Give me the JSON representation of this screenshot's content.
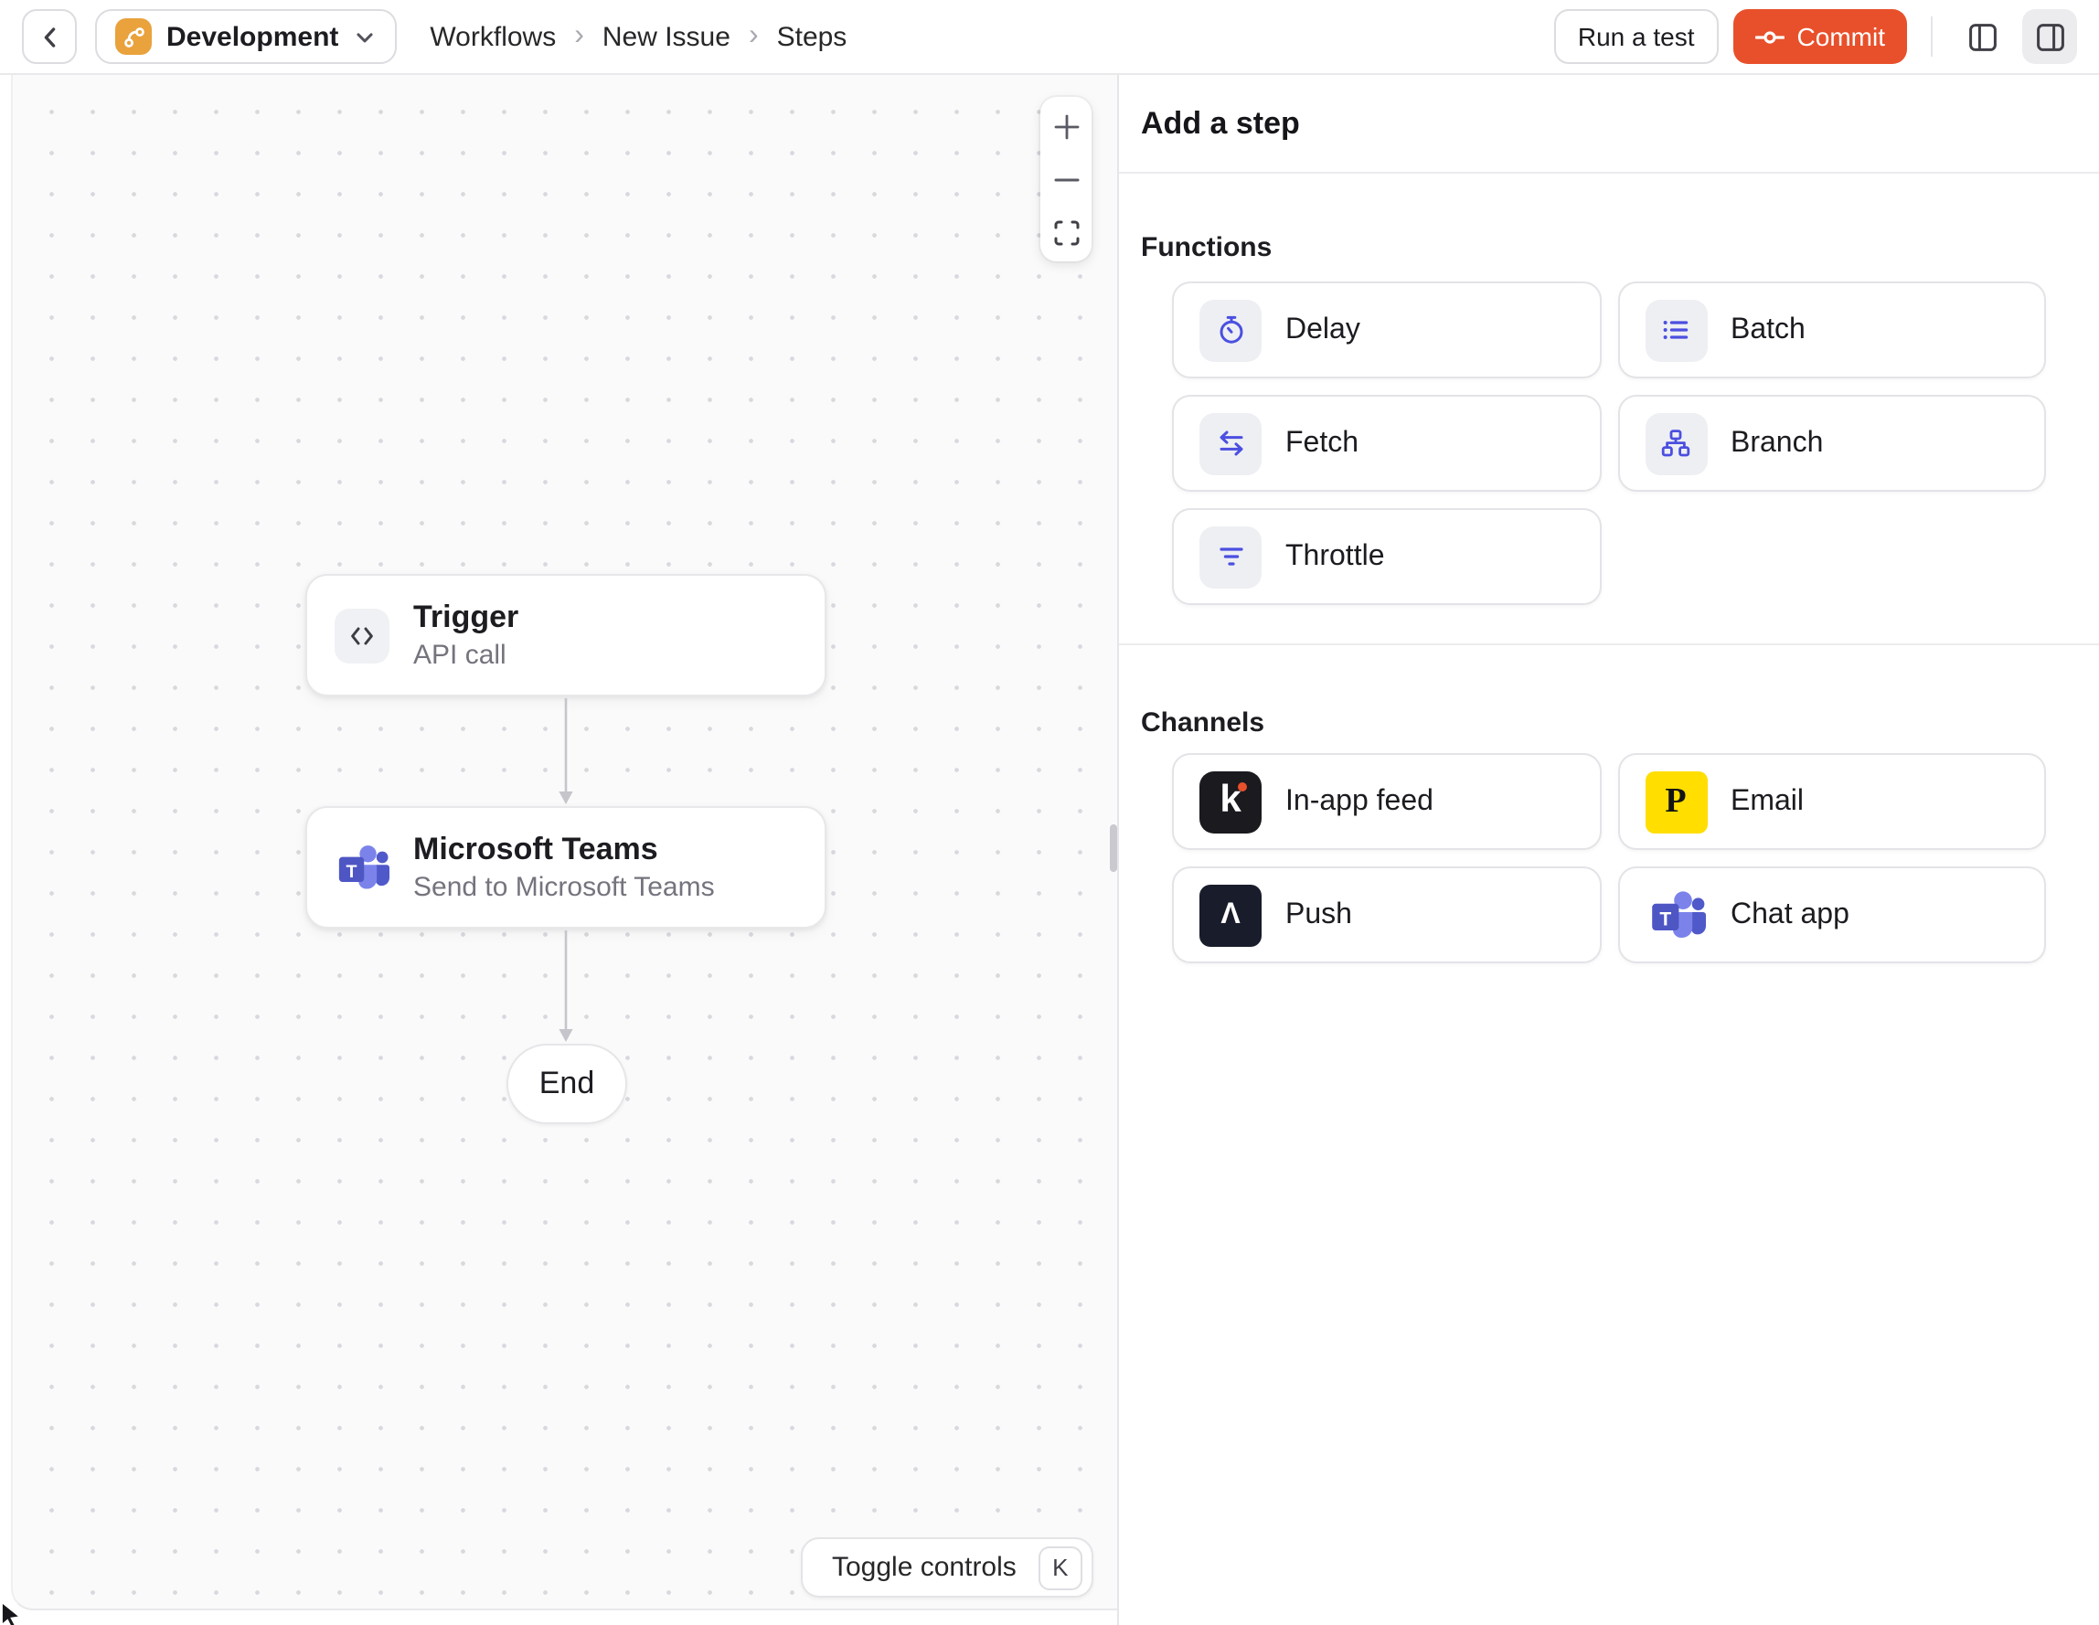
{
  "topbar": {
    "environment": "Development",
    "breadcrumb": {
      "items": [
        "Workflows",
        "New Issue",
        "Steps"
      ],
      "separator": "›"
    },
    "run_test": "Run a test",
    "commit": "Commit"
  },
  "canvas": {
    "trigger": {
      "title": "Trigger",
      "subtitle": "API call"
    },
    "teams": {
      "title": "Microsoft Teams",
      "subtitle": "Send to Microsoft Teams"
    },
    "end": "End",
    "toggle_controls": "Toggle controls",
    "toggle_shortcut": "K"
  },
  "panel": {
    "title": "Add a step",
    "functions": {
      "heading": "Functions",
      "items": [
        {
          "label": "Delay",
          "icon": "timer-icon"
        },
        {
          "label": "Batch",
          "icon": "list-icon"
        },
        {
          "label": "Fetch",
          "icon": "swap-arrows-icon"
        },
        {
          "label": "Branch",
          "icon": "org-chart-icon"
        },
        {
          "label": "Throttle",
          "icon": "filter-lines-icon"
        }
      ]
    },
    "channels": {
      "heading": "Channels",
      "items": [
        {
          "label": "In-app feed",
          "icon": "knock-icon"
        },
        {
          "label": "Email",
          "icon": "postmark-icon"
        },
        {
          "label": "Push",
          "icon": "push-caret-icon"
        },
        {
          "label": "Chat app",
          "icon": "microsoft-teams-icon"
        }
      ]
    }
  },
  "logos": {
    "knock_letter": "k",
    "postmark_letter": "P",
    "push_letter": "Λ",
    "teams_letter": "T"
  },
  "colors": {
    "commit_orange": "#E8502B",
    "environment_orange": "#E9A23C",
    "function_icon_indigo": "#4B4FE0",
    "teams_purple": "#5059C9",
    "postmark_yellow": "#FFDE00",
    "canvas_background": "#FAFAFA"
  }
}
